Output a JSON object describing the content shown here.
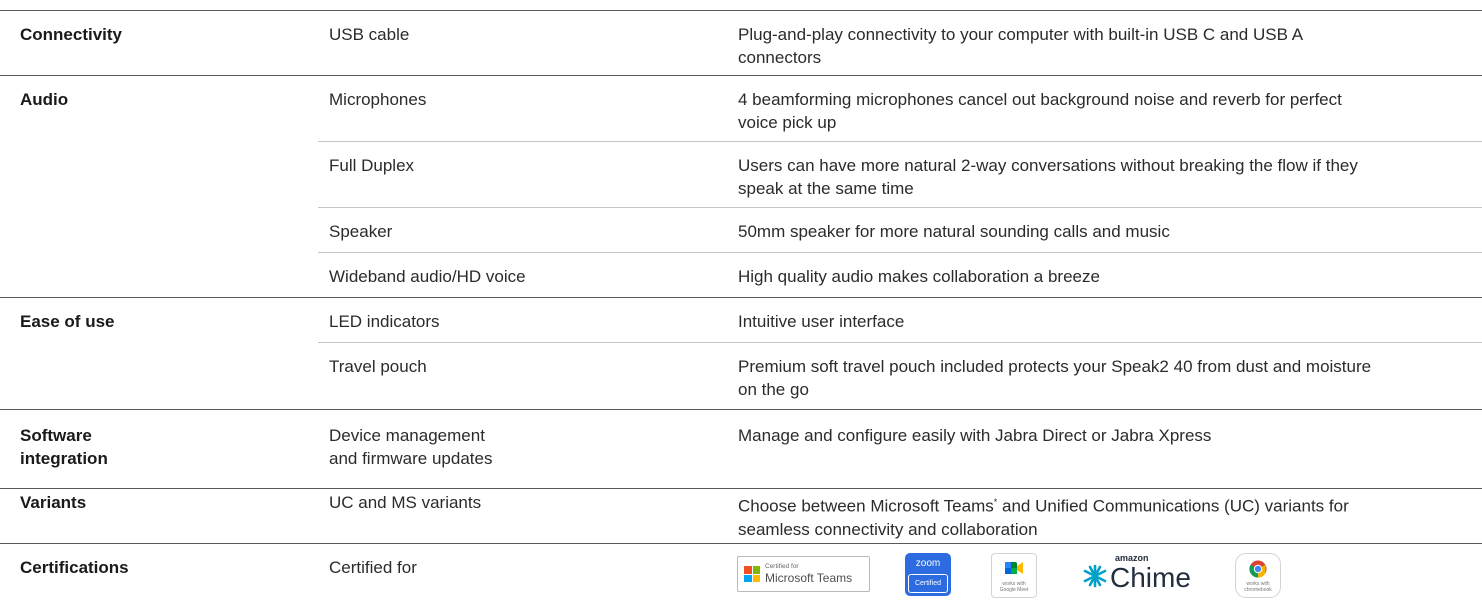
{
  "rows": {
    "connectivity": {
      "category": "Connectivity",
      "items": [
        {
          "feature": "USB cable",
          "description": "Plug-and-play connectivity to your computer with built-in USB C and USB A connectors"
        }
      ]
    },
    "audio": {
      "category": "Audio",
      "items": [
        {
          "feature": "Microphones",
          "description": "4 beamforming microphones cancel out background noise and reverb for perfect voice pick up"
        },
        {
          "feature": "Full Duplex",
          "description": "Users can have more natural 2-way conversations without breaking the flow if they speak at the same time"
        },
        {
          "feature": "Speaker",
          "description": "50mm speaker for more natural sounding calls and music"
        },
        {
          "feature": "Wideband audio/HD voice",
          "description": "High quality audio makes collaboration a breeze"
        }
      ]
    },
    "ease_of_use": {
      "category": "Ease of use",
      "items": [
        {
          "feature": "LED indicators",
          "description": "Intuitive user interface"
        },
        {
          "feature": "Travel pouch",
          "description": "Premium soft travel pouch included protects your Speak2 40 from dust and moisture on the go"
        }
      ]
    },
    "software": {
      "category_line1": "Software",
      "category_line2": "integration",
      "items": [
        {
          "feature_line1": "Device management",
          "feature_line2": "and firmware updates",
          "description": "Manage and configure easily with Jabra Direct or Jabra Xpress"
        }
      ]
    },
    "variants": {
      "category": "Variants",
      "items": [
        {
          "feature": "UC and MS variants",
          "description_part1": "Choose between Microsoft Teams",
          "description_sup": "*",
          "description_part2": " and Unified Communications (UC) variants for seamless connectivity and collaboration"
        }
      ]
    },
    "certifications": {
      "category": "Certifications",
      "items": [
        {
          "feature": "Certified for"
        }
      ]
    }
  },
  "logos": {
    "teams": {
      "small": "Certified for",
      "big": "Microsoft Teams",
      "icon": "microsoft-logo"
    },
    "zoom": {
      "top": "zoom",
      "bottom": "Certified"
    },
    "meet": {
      "line1": "works with",
      "line2": "Google Meet",
      "icon": "video-camera-icon"
    },
    "chime": {
      "small": "amazon",
      "big": "Chime",
      "icon": "chime-icon"
    },
    "chromebook": {
      "line1": "works with",
      "line2": "chromebook",
      "icon": "chrome-icon"
    }
  },
  "colors": {
    "text": "#1a1a1a",
    "divider_major": "#5a5a5a",
    "divider_minor": "#c7c7c7",
    "zoom_blue": "#2d6be0",
    "ms_red": "#f25022",
    "ms_green": "#7fba00",
    "ms_blue": "#00a4ef",
    "ms_yellow": "#ffb900"
  }
}
